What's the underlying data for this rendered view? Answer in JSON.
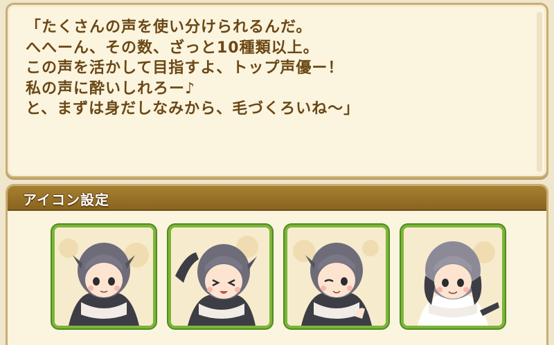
{
  "dialog": {
    "lines": [
      "「たくさんの声を使い分けられるんだ。",
      "へへーん、その数、ざっと10種類以上。",
      "この声を活かして目指すよ、トップ声優ー！",
      "私の声に酔いしれろー♪",
      "と、まずは身だしなみから、毛づくろいね～」"
    ]
  },
  "icon_settings": {
    "title": "アイコン設定",
    "icons": [
      {
        "name": "penguin-girl-icon-neutral"
      },
      {
        "name": "penguin-girl-icon-laughing"
      },
      {
        "name": "penguin-girl-icon-wink"
      },
      {
        "name": "penguin-girl-icon-smile"
      }
    ]
  },
  "colors": {
    "text": "#6a4714",
    "header": "#9a7228",
    "card_border": "#7cb63a"
  }
}
